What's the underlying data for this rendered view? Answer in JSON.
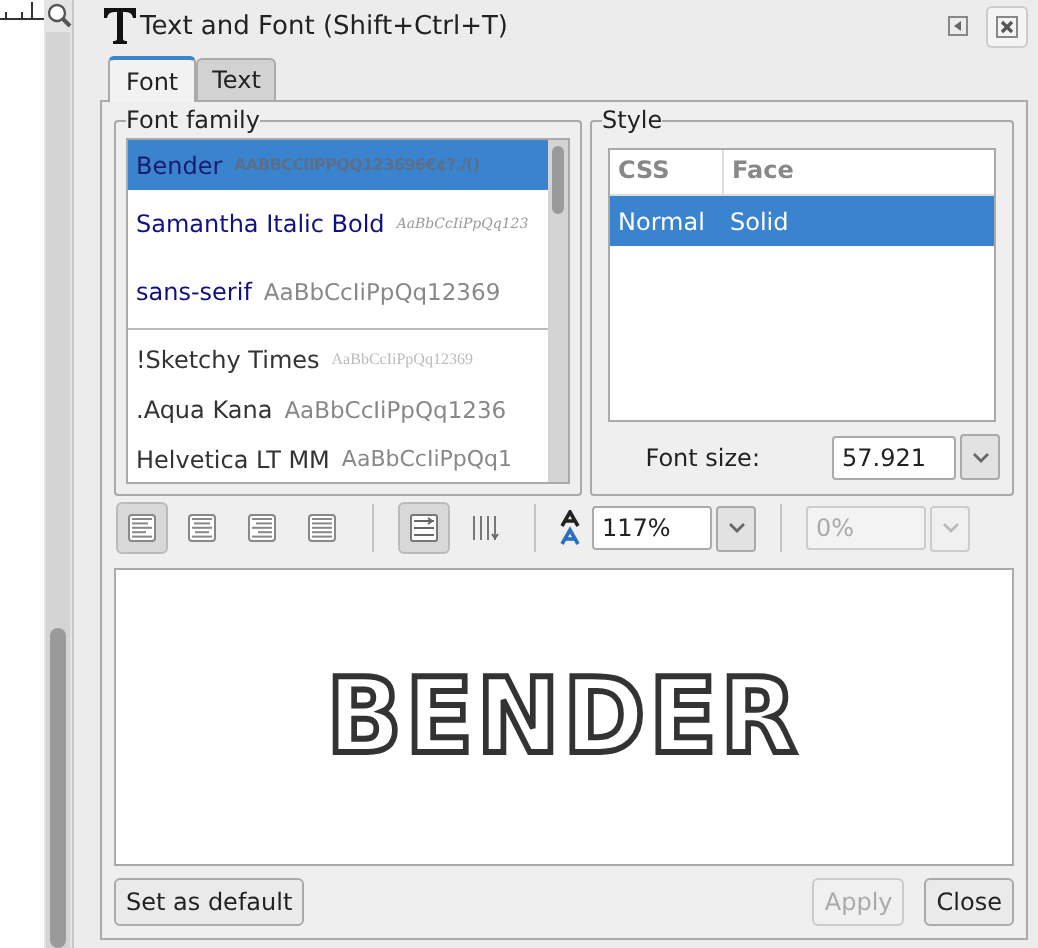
{
  "dialog": {
    "title": "Text and Font (Shift+Ctrl+T)"
  },
  "tabs": [
    {
      "label": "Font",
      "selected": true
    },
    {
      "label": "Text",
      "selected": false
    }
  ],
  "font_family": {
    "label": "Font family",
    "items": [
      {
        "name": "Bender",
        "sample": "AABBCCIIPPQQ123696€¢?./()",
        "selected": true,
        "kind": "document"
      },
      {
        "name": "Samantha Italic Bold",
        "sample": "AaBbCcIiPpQq123",
        "selected": false,
        "kind": "document"
      },
      {
        "name": "sans-serif",
        "sample": "AaBbCcIiPpQq12369",
        "selected": false,
        "kind": "document"
      },
      {
        "name": "!Sketchy Times",
        "sample": "AaBbCcIiPpQq12369",
        "selected": false,
        "kind": "system"
      },
      {
        "name": ".Aqua Kana",
        "sample": "AaBbCcIiPpQq1236",
        "selected": false,
        "kind": "system"
      },
      {
        "name": "Helvetica LT MM",
        "sample": "AaBbCcIiPpQq1",
        "selected": false,
        "kind": "system"
      }
    ]
  },
  "style": {
    "label": "Style",
    "columns": [
      "CSS",
      "Face"
    ],
    "rows": [
      {
        "css": "Normal",
        "face": "Solid",
        "selected": true
      }
    ],
    "font_size_label": "Font size:",
    "font_size": "57.921"
  },
  "toolbar": {
    "alignments": [
      {
        "kind": "left",
        "selected": true
      },
      {
        "kind": "center",
        "selected": false
      },
      {
        "kind": "right",
        "selected": false
      },
      {
        "kind": "justify",
        "selected": false
      }
    ],
    "orientations": [
      {
        "kind": "horizontal",
        "selected": true
      },
      {
        "kind": "vertical",
        "selected": false
      }
    ],
    "line_spacing": "117%",
    "spacing": {
      "value": "0%",
      "disabled": true
    }
  },
  "preview": "BENDER",
  "buttons": [
    {
      "label": "Set as default",
      "disabled": false
    },
    {
      "label": "Apply",
      "disabled": true
    },
    {
      "label": "Close",
      "disabled": false
    }
  ]
}
